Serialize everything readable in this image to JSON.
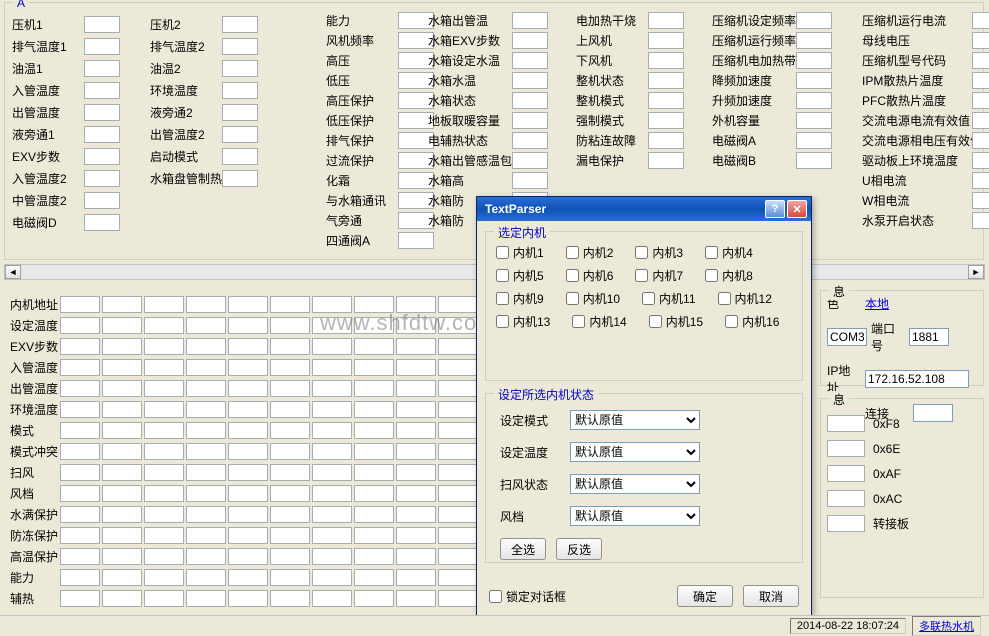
{
  "panelA_title": "A",
  "colA": [
    "压机1",
    "排气温度1",
    "油温1",
    "入管温度",
    "出管温度",
    "液旁通1",
    "EXV步数",
    "入管温度2",
    "中管温度2",
    "电磁阀D"
  ],
  "colB": [
    "压机2",
    "排气温度2",
    "油温2",
    "环境温度",
    "液旁通2",
    "出管温度2",
    "启动模式",
    "水箱盘管制热量"
  ],
  "colC": [
    "能力",
    "风机频率",
    "高压",
    "低压",
    "高压保护",
    "低压保护",
    "排气保护",
    "过流保护",
    "化霜",
    "与水箱通讯",
    "气旁通",
    "四通阀A"
  ],
  "colD": [
    "水箱出管温",
    "水箱EXV步数",
    "水箱设定水温",
    "水箱水温",
    "水箱状态",
    "地板取暖容量",
    "电辅热状态",
    "水箱出管感温包",
    "水箱高",
    "水箱防",
    "水箱防"
  ],
  "colE": [
    "电加热干烧",
    "上风机",
    "下风机",
    "整机状态",
    "整机模式",
    "强制模式",
    "防粘连故障",
    "漏电保护"
  ],
  "colF": [
    "压缩机设定频率",
    "压缩机运行频率",
    "压缩机电加热带",
    "降频加速度",
    "升频加速度",
    "外机容量",
    "电磁阀A",
    "电磁阀B"
  ],
  "colG": [
    "压缩机运行电流",
    "母线电压",
    "压缩机型号代码",
    "IPM散热片温度",
    "PFC散热片温度",
    "交流电源电流有效值",
    "交流电源相电压有效值",
    "驱动板上环境温度",
    "U相电流",
    "W相电流",
    "水泵开启状态"
  ],
  "gridRows": [
    "内机地址",
    "设定温度",
    "EXV步数",
    "入管温度",
    "出管温度",
    "环境温度",
    "模式",
    "模式冲突",
    "扫风",
    "风档",
    "水满保护",
    "防冻保护",
    "高温保护",
    "能力",
    "辅热"
  ],
  "dialog": {
    "title": "TextParser",
    "group1": "选定内机",
    "units": [
      "内机1",
      "内机2",
      "内机3",
      "内机4",
      "内机5",
      "内机6",
      "内机7",
      "内机8",
      "内机9",
      "内机10",
      "内机11",
      "内机12",
      "内机13",
      "内机14",
      "内机15",
      "内机16"
    ],
    "group2": "设定所选内机状态",
    "rows": [
      "设定模式",
      "设定温度",
      "扫风状态",
      "风档"
    ],
    "default_opt": "默认原值",
    "select_all": "全选",
    "invert": "反选",
    "lock": "锁定对话框",
    "ok": "确定",
    "cancel": "取消"
  },
  "conn": {
    "title": "息",
    "role_lbl": "色",
    "role_val": "本地",
    "com_val": "COM3",
    "port_lbl": "端口号",
    "port_val": "1881",
    "ip_lbl": "IP地址",
    "ip_val": "172.16.52.108",
    "connect": "连接"
  },
  "status": {
    "title": "息",
    "vals": [
      "0xF8",
      "0x6E",
      "0xAF",
      "0xAC"
    ],
    "board": "转接板"
  },
  "footer": {
    "ts": "2014-08-22 18:07:24",
    "mode": "多联热水机"
  },
  "watermark": "www.shfdtw.com"
}
